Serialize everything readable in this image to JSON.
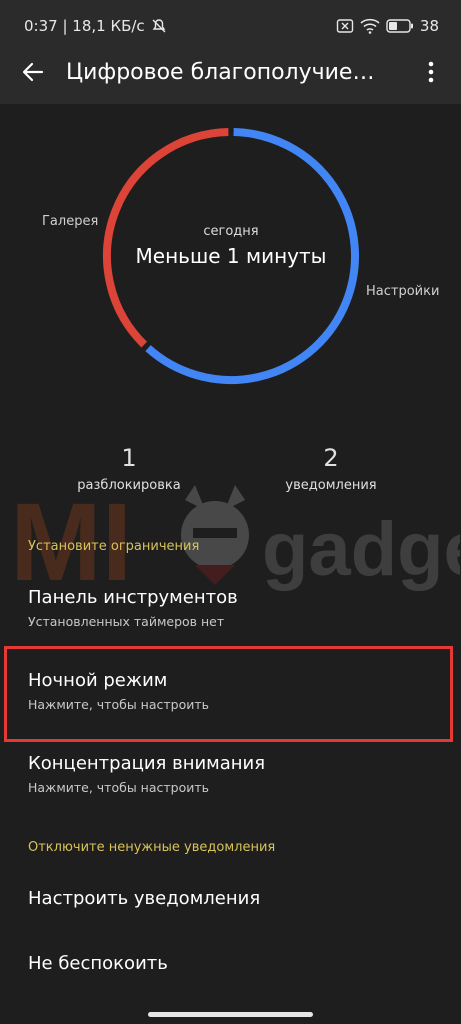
{
  "status_bar": {
    "time_speed": "0:37 | 18,1 КБ/с",
    "battery": "38"
  },
  "app_bar": {
    "title": "Цифровое благополучие…",
    "back_icon": "arrow-left-icon",
    "menu_icon": "more-vert-icon"
  },
  "usage_ring": {
    "today_label": "сегодня",
    "value": "Меньше 1 минуты",
    "left_app": "Галерея",
    "right_app": "Настройки",
    "segments": [
      {
        "app": "Настройки",
        "share": 0.62,
        "color": "#4285f4"
      },
      {
        "app": "Галерея",
        "share": 0.38,
        "color": "#db4437"
      }
    ]
  },
  "stats": {
    "unlocks_value": "1",
    "unlocks_label": "разблокировка",
    "notifications_value": "2",
    "notifications_label": "уведомления"
  },
  "sections": {
    "limits_header": "Установите ограничения",
    "dashboard_title": "Панель инструментов",
    "dashboard_sub": "Установленных таймеров нет",
    "night_title": "Ночной режим",
    "night_sub": "Нажмите, чтобы настроить",
    "focus_title": "Концентрация внимания",
    "focus_sub": "Нажмите, чтобы настроить",
    "notif_header": "Отключите ненужные уведомления",
    "manage_notif_title": "Настроить уведомления",
    "dnd_title": "Не беспокоить"
  },
  "watermark": {
    "text_left": "MI",
    "text_right": "gadget"
  },
  "colors": {
    "accent_header": "#d8c25a",
    "highlight_border": "#e53935",
    "background": "#1e1e1e"
  }
}
